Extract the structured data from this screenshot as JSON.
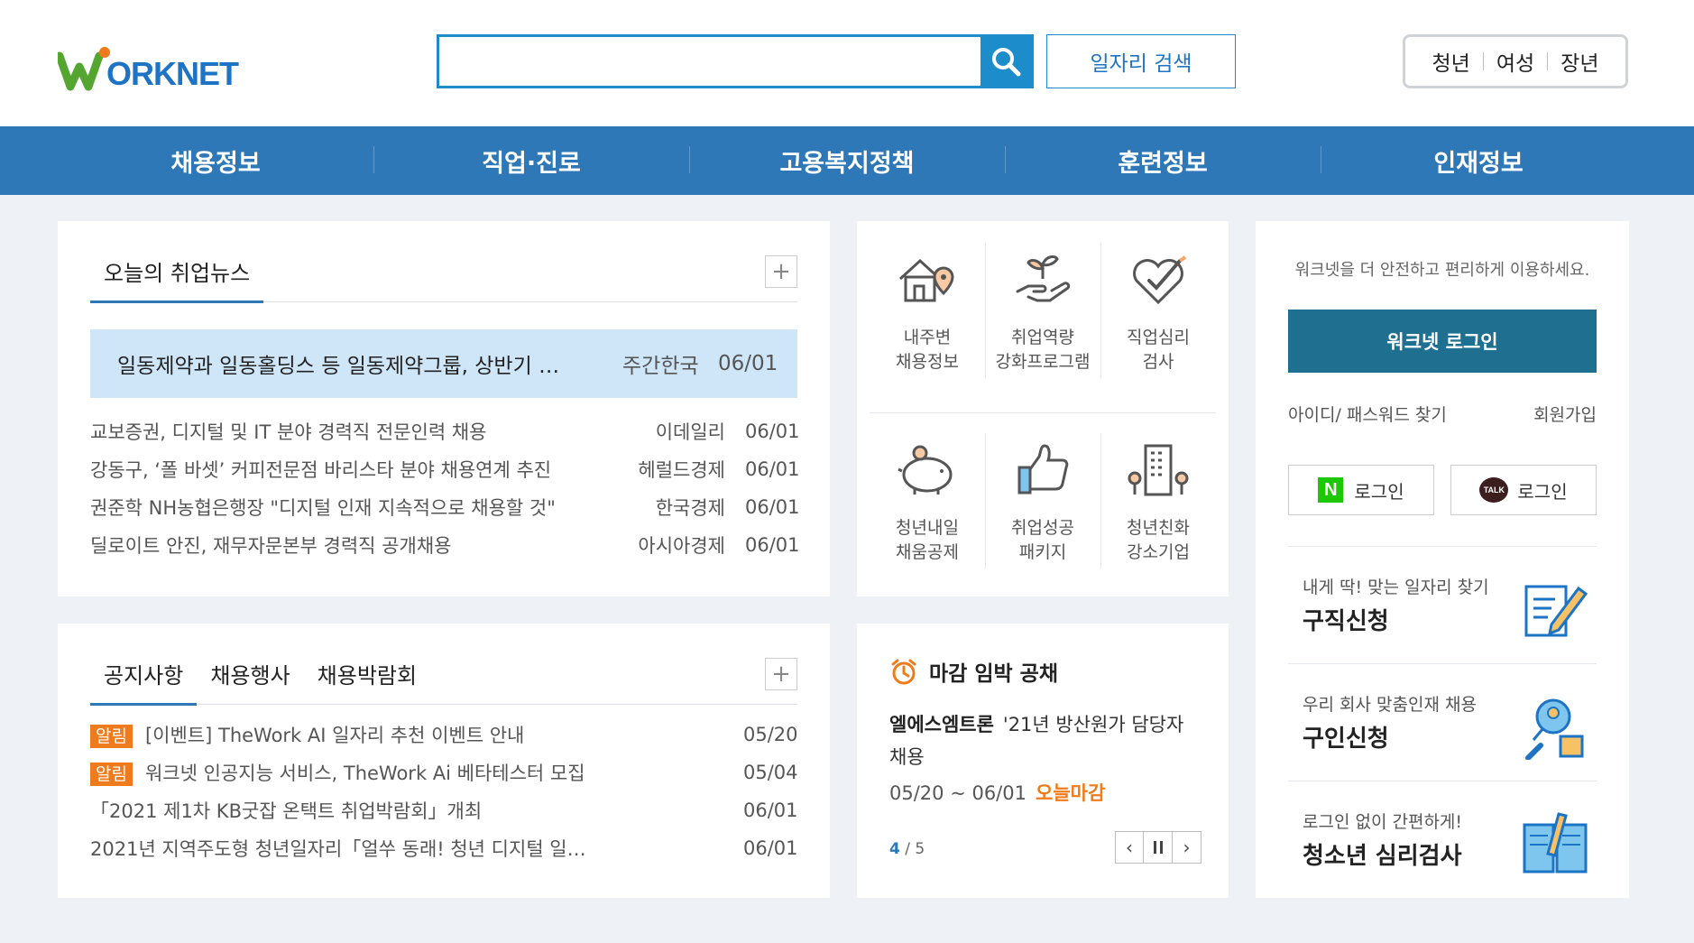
{
  "header": {
    "logo": "WORKNET",
    "search_placeholder": "",
    "job_search_label": "일자리 검색",
    "targets": [
      "청년",
      "여성",
      "장년"
    ]
  },
  "nav": [
    "채용정보",
    "직업·진로",
    "고용복지정책",
    "훈련정보",
    "인재정보"
  ],
  "news": {
    "tab": "오늘의 취업뉴스",
    "headline": {
      "title": "일동제약과 일동홀딩스 등 일동제약그룹, 상반기 …",
      "source": "주간한국",
      "date": "06/01"
    },
    "items": [
      {
        "title": "교보증권, 디지털 및 IT 분야 경력직 전문인력 채용",
        "source": "이데일리",
        "date": "06/01"
      },
      {
        "title": "강동구, ‘폴 바셋’ 커피전문점 바리스타 분야 채용연계 추진",
        "source": "헤럴드경제",
        "date": "06/01"
      },
      {
        "title": "권준학 NH농협은행장 \"디지털 인재 지속적으로 채용할 것\"",
        "source": "한국경제",
        "date": "06/01"
      },
      {
        "title": "딜로이트 안진, 재무자문본부 경력직 공개채용",
        "source": "아시아경제",
        "date": "06/01"
      }
    ]
  },
  "quick_menu": [
    {
      "line1": "내주변",
      "line2": "채용정보",
      "icon": "house-location-icon"
    },
    {
      "line1": "취업역량",
      "line2": "강화프로그램",
      "icon": "sprout-hand-icon"
    },
    {
      "line1": "직업심리",
      "line2": "검사",
      "icon": "heart-check-icon"
    },
    {
      "line1": "청년내일",
      "line2": "채움공제",
      "icon": "piggy-bank-icon"
    },
    {
      "line1": "취업성공",
      "line2": "패키지",
      "icon": "thumbs-up-icon"
    },
    {
      "line1": "청년친화",
      "line2": "강소기업",
      "icon": "building-icon"
    }
  ],
  "login": {
    "message": "워크넷을 더 안전하고 편리하게 이용하세요.",
    "login_button": "워크넷 로그인",
    "find_id": "아이디/ 패스워드 찾기",
    "signup": "회원가입",
    "naver_login": "로그인",
    "kakao_login": "로그인",
    "kakao_mark": "TALK",
    "naver_mark": "N",
    "services": [
      {
        "sub": "내게 딱! 맞는 일자리 찾기",
        "main": "구직신청",
        "icon": "resume-pencil-icon"
      },
      {
        "sub": "우리 회사 맞춤인재 채용",
        "main": "구인신청",
        "icon": "magnifier-person-icon"
      },
      {
        "sub": "로그인 없이 간편하게!",
        "main": "청소년 심리검사",
        "icon": "book-pencil-icon"
      }
    ]
  },
  "notice": {
    "tabs": [
      "공지사항",
      "채용행사",
      "채용박람회"
    ],
    "items": [
      {
        "badge": "알림",
        "title": "[이벤트] TheWork AI 일자리 추천 이벤트 안내",
        "date": "05/20"
      },
      {
        "badge": "알림",
        "title": "워크넷 인공지능 서비스, TheWork Ai 베타테스터 모집",
        "date": "05/04"
      },
      {
        "badge": "",
        "title": "「2021 제1차 KB굿잡 온택트 취업박람회」개최",
        "date": "06/01"
      },
      {
        "badge": "",
        "title": "2021년 지역주도형 청년일자리「얼쑤 동래! 청년 디지털 일…",
        "date": "06/01"
      }
    ]
  },
  "deadline": {
    "title": "마감 임박 공채",
    "company": "엘에스엠트론",
    "job": "'21년 방산원가 담당자 채용",
    "period": "05/20 ~ 06/01",
    "today_label": "오늘마감",
    "page_current": "4",
    "page_total": "/ 5"
  },
  "colors": {
    "nav": "#2e78b7",
    "accent": "#1d8cca",
    "badge": "#f07b1c",
    "login_button": "#1f6f91"
  }
}
